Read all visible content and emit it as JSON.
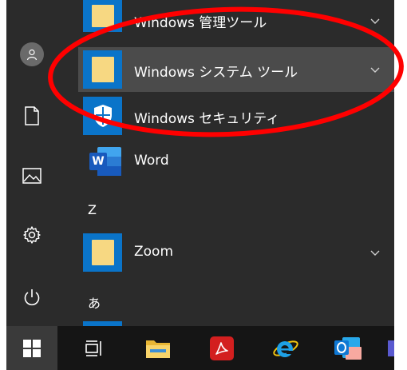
{
  "colors": {
    "panel": "#2b2b2b",
    "highlight": "#4b4b4b",
    "tile_blue": "#0a74c9",
    "annotation_ring": "#ff0000",
    "taskbar": "#151515"
  },
  "rail": {
    "items": [
      {
        "icon": "user-icon"
      },
      {
        "icon": "document-icon"
      },
      {
        "icon": "pictures-icon"
      },
      {
        "icon": "settings-gear-icon"
      },
      {
        "icon": "power-icon"
      }
    ]
  },
  "apps": {
    "kanri": {
      "label": "Windows 管理ツール"
    },
    "system": {
      "label": "Windows システム ツール"
    },
    "security": {
      "label": "Windows セキュリティ"
    },
    "word": {
      "label": "Word",
      "tile_text": "W"
    },
    "zoom": {
      "label": "Zoom"
    }
  },
  "sections": {
    "z": {
      "letter": "Z"
    },
    "a": {
      "letter": "あ"
    }
  },
  "taskbar": {
    "items": [
      {
        "icon": "windows-start-icon"
      },
      {
        "icon": "task-view-icon"
      },
      {
        "icon": "file-explorer-icon"
      },
      {
        "icon": "adobe-acrobat-icon"
      },
      {
        "icon": "internet-explorer-icon"
      },
      {
        "icon": "outlook-icon"
      }
    ]
  }
}
